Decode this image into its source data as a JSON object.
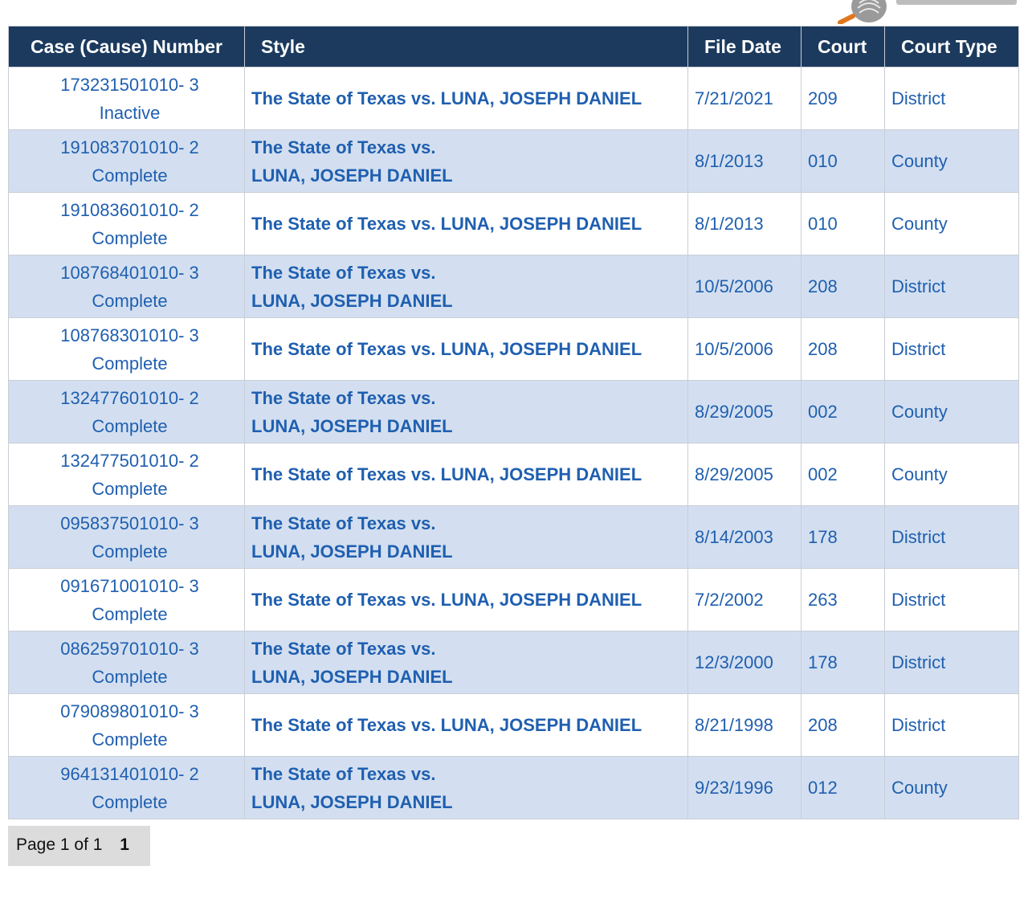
{
  "table": {
    "headers": {
      "case_number": "Case (Cause) Number",
      "style": "Style",
      "file_date": "File Date",
      "court": "Court",
      "court_type": "Court Type"
    },
    "rows": [
      {
        "case_number": "173231501010- 3",
        "status": "Inactive",
        "style_line1": "The State of Texas vs. LUNA, JOSEPH DANIEL",
        "style_line2": "",
        "file_date": "7/21/2021",
        "court": "209",
        "court_type": "District"
      },
      {
        "case_number": "191083701010- 2",
        "status": "Complete",
        "style_line1": "The State of Texas vs.",
        "style_line2": "LUNA, JOSEPH DANIEL",
        "file_date": "8/1/2013",
        "court": "010",
        "court_type": "County"
      },
      {
        "case_number": "191083601010- 2",
        "status": "Complete",
        "style_line1": "The State of Texas vs. LUNA, JOSEPH DANIEL",
        "style_line2": "",
        "file_date": "8/1/2013",
        "court": "010",
        "court_type": "County"
      },
      {
        "case_number": "108768401010- 3",
        "status": "Complete",
        "style_line1": "The State of Texas vs.",
        "style_line2": "LUNA, JOSEPH DANIEL",
        "file_date": "10/5/2006",
        "court": "208",
        "court_type": "District"
      },
      {
        "case_number": "108768301010- 3",
        "status": "Complete",
        "style_line1": "The State of Texas vs. LUNA, JOSEPH DANIEL",
        "style_line2": "",
        "file_date": "10/5/2006",
        "court": "208",
        "court_type": "District"
      },
      {
        "case_number": "132477601010- 2",
        "status": "Complete",
        "style_line1": "The State of Texas vs.",
        "style_line2": "LUNA, JOSEPH DANIEL",
        "file_date": "8/29/2005",
        "court": "002",
        "court_type": "County"
      },
      {
        "case_number": "132477501010- 2",
        "status": "Complete",
        "style_line1": "The State of Texas vs. LUNA, JOSEPH DANIEL",
        "style_line2": "",
        "file_date": "8/29/2005",
        "court": "002",
        "court_type": "County"
      },
      {
        "case_number": "095837501010- 3",
        "status": "Complete",
        "style_line1": "The State of Texas vs.",
        "style_line2": "LUNA, JOSEPH DANIEL",
        "file_date": "8/14/2003",
        "court": "178",
        "court_type": "District"
      },
      {
        "case_number": "091671001010- 3",
        "status": "Complete",
        "style_line1": "The State of Texas vs. LUNA, JOSEPH DANIEL",
        "style_line2": "",
        "file_date": "7/2/2002",
        "court": "263",
        "court_type": "District"
      },
      {
        "case_number": "086259701010- 3",
        "status": "Complete",
        "style_line1": "The State of Texas vs.",
        "style_line2": "LUNA, JOSEPH DANIEL",
        "file_date": "12/3/2000",
        "court": "178",
        "court_type": "District"
      },
      {
        "case_number": "079089801010- 3",
        "status": "Complete",
        "style_line1": "The State of Texas vs. LUNA, JOSEPH DANIEL",
        "style_line2": "",
        "file_date": "8/21/1998",
        "court": "208",
        "court_type": "District"
      },
      {
        "case_number": "964131401010- 2",
        "status": "Complete",
        "style_line1": "The State of Texas vs.",
        "style_line2": "LUNA, JOSEPH DANIEL",
        "file_date": "9/23/1996",
        "court": "012",
        "court_type": "County"
      }
    ]
  },
  "pager": {
    "label": "Page 1 of 1",
    "current_page": "1"
  },
  "colors": {
    "header_bg": "#1b3a5e",
    "link": "#1f5fb0",
    "row_alt": "#d3dff0"
  }
}
